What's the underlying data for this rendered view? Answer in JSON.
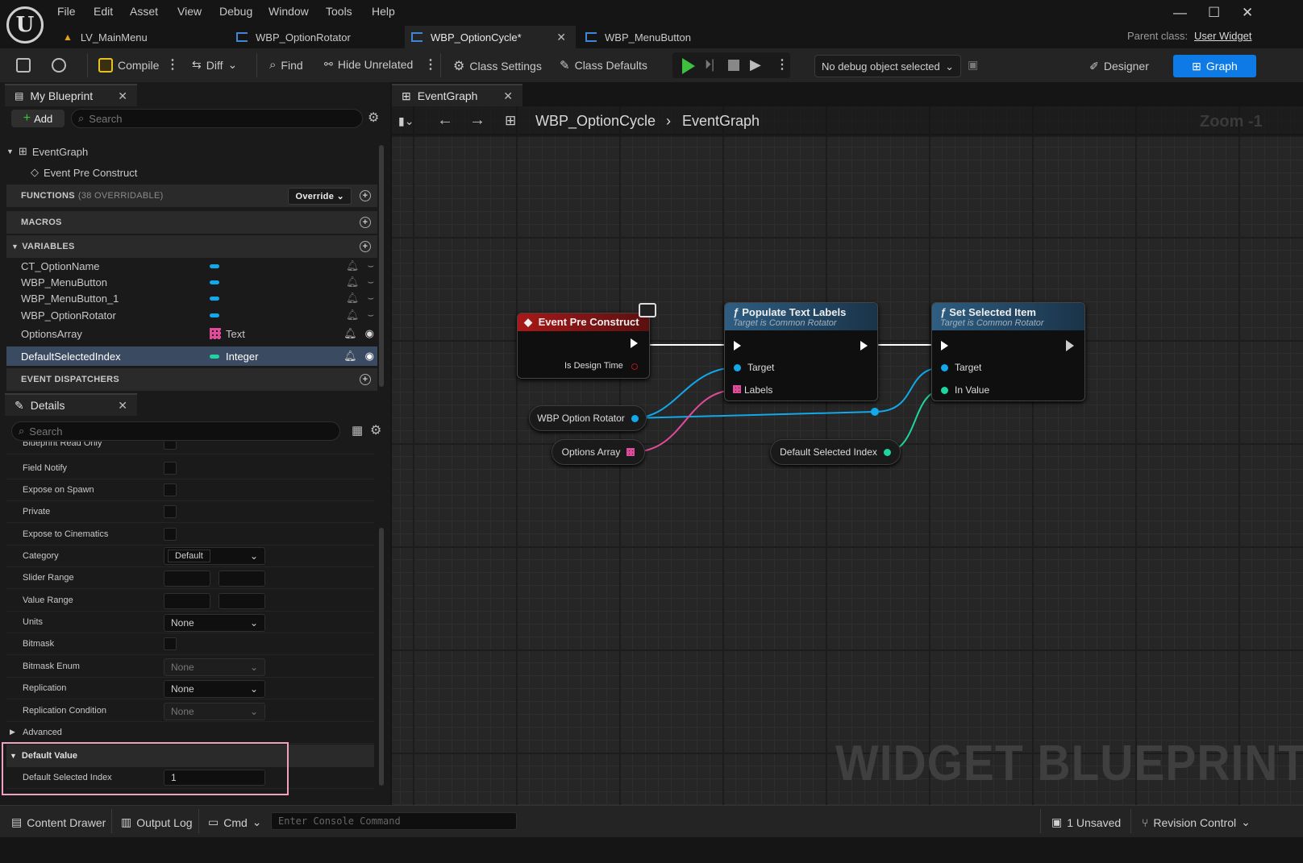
{
  "menu": [
    "File",
    "Edit",
    "Asset",
    "View",
    "Debug",
    "Window",
    "Tools",
    "Help"
  ],
  "doc_tabs": [
    "LV_MainMenu",
    "WBP_OptionRotator",
    "WBP_OptionCycle*",
    "WBP_MenuButton"
  ],
  "parent_class_label": "Parent class:",
  "parent_class_value": "User Widget",
  "toolbar": {
    "compile": "Compile",
    "diff": "Diff",
    "find": "Find",
    "hide_unrelated": "Hide Unrelated",
    "class_settings": "Class Settings",
    "class_defaults": "Class Defaults",
    "debug_object": "No debug object selected",
    "designer": "Designer",
    "graph": "Graph"
  },
  "my_blueprint": {
    "tab": "My Blueprint",
    "add": "Add",
    "search_placeholder": "Search",
    "eventgraph": "EventGraph",
    "event_item": "Event Pre Construct",
    "functions": "FUNCTIONS",
    "functions_count": "(38 OVERRIDABLE)",
    "override": "Override",
    "macros": "MACROS",
    "variables": "VARIABLES",
    "event_dispatchers": "EVENT DISPATCHERS",
    "vars": [
      {
        "name": "CT_OptionName",
        "type": ""
      },
      {
        "name": "WBP_MenuButton",
        "type": ""
      },
      {
        "name": "WBP_MenuButton_1",
        "type": ""
      },
      {
        "name": "WBP_OptionRotator",
        "type": ""
      },
      {
        "name": "OptionsArray",
        "type": "Text"
      },
      {
        "name": "DefaultSelectedIndex",
        "type": "Integer"
      }
    ]
  },
  "details": {
    "tab": "Details",
    "search_placeholder": "Search",
    "cut_row": "Blueprint Read Only",
    "field_notify": "Field Notify",
    "expose_on_spawn": "Expose on Spawn",
    "private": "Private",
    "expose_cinematics": "Expose to Cinematics",
    "category": "Category",
    "category_value": "Default",
    "slider_range": "Slider Range",
    "value_range": "Value Range",
    "units": "Units",
    "units_value": "None",
    "bitmask": "Bitmask",
    "bitmask_enum": "Bitmask Enum",
    "bitmask_enum_value": "None",
    "replication": "Replication",
    "replication_value": "None",
    "replication_condition": "Replication Condition",
    "replication_condition_value": "None",
    "advanced": "Advanced",
    "default_value": "Default Value",
    "default_selected_index": "Default Selected Index",
    "default_selected_index_value": "1"
  },
  "graph": {
    "tab": "EventGraph",
    "crumb_bp": "WBP_OptionCycle",
    "crumb_graph": "EventGraph",
    "zoom": "Zoom -1",
    "watermark": "WIDGET BLUEPRINT",
    "event_node": {
      "title": "Event Pre Construct",
      "pin": "Is Design Time"
    },
    "populate_node": {
      "title": "Populate Text Labels",
      "sub": "Target is Common Rotator",
      "pin_target": "Target",
      "pin_labels": "Labels"
    },
    "set_node": {
      "title": "Set Selected Item",
      "sub": "Target is Common Rotator",
      "pin_target": "Target",
      "pin_value": "In Value"
    },
    "var_rotator": "WBP Option Rotator",
    "var_options": "Options Array",
    "var_default": "Default Selected Index"
  },
  "bottom": {
    "content_drawer": "Content Drawer",
    "output_log": "Output Log",
    "cmd": "Cmd",
    "console_placeholder": "Enter Console Command",
    "unsaved": "1 Unsaved",
    "revision": "Revision Control"
  },
  "colors": {
    "accent": "#0e7ae6",
    "object_pin": "#12a8ea",
    "int_pin": "#1ed4a0",
    "array_text_pin": "#e04a9a",
    "event_red": "#a81818",
    "highlight": "#f0a0c0"
  }
}
